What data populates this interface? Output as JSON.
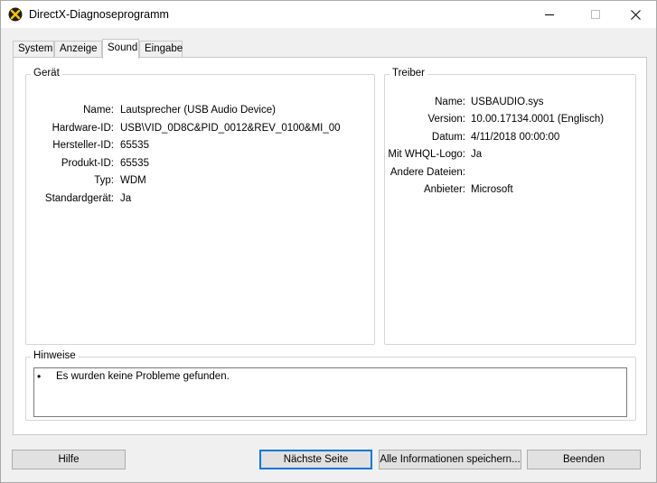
{
  "window": {
    "title": "DirectX-Diagnoseprogramm",
    "icon": "directx-icon"
  },
  "tabs": [
    {
      "label": "System"
    },
    {
      "label": "Anzeige"
    },
    {
      "label": "Sound",
      "active": true
    },
    {
      "label": "Eingabe"
    }
  ],
  "device": {
    "title": "Gerät",
    "rows": [
      {
        "label": "Name:",
        "value": "Lautsprecher (USB Audio Device)"
      },
      {
        "label": "Hardware-ID:",
        "value": "USB\\VID_0D8C&PID_0012&REV_0100&MI_00"
      },
      {
        "label": "Hersteller-ID:",
        "value": "65535"
      },
      {
        "label": "Produkt-ID:",
        "value": "65535"
      },
      {
        "label": "Typ:",
        "value": "WDM"
      },
      {
        "label": "Standardgerät:",
        "value": "Ja"
      }
    ]
  },
  "driver": {
    "title": "Treiber",
    "rows": [
      {
        "label": "Name:",
        "value": "USBAUDIO.sys"
      },
      {
        "label": "Version:",
        "value": "10.00.17134.0001 (Englisch)"
      },
      {
        "label": "Datum:",
        "value": "4/11/2018 00:00:00"
      },
      {
        "label": "Mit WHQL-Logo:",
        "value": "Ja"
      },
      {
        "label": "Andere Dateien:",
        "value": ""
      },
      {
        "label": "Anbieter:",
        "value": "Microsoft"
      }
    ]
  },
  "notes": {
    "title": "Hinweise",
    "bullet": "•",
    "text": "Es wurden keine Probleme gefunden."
  },
  "buttons": {
    "help": "Hilfe",
    "next": "Nächste Seite",
    "save_all": "Alle Informationen speichern...",
    "quit": "Beenden"
  },
  "colors": {
    "accent": "#0078d7",
    "panel_bg": "#ffffff",
    "window_bg": "#f0f0f0"
  }
}
